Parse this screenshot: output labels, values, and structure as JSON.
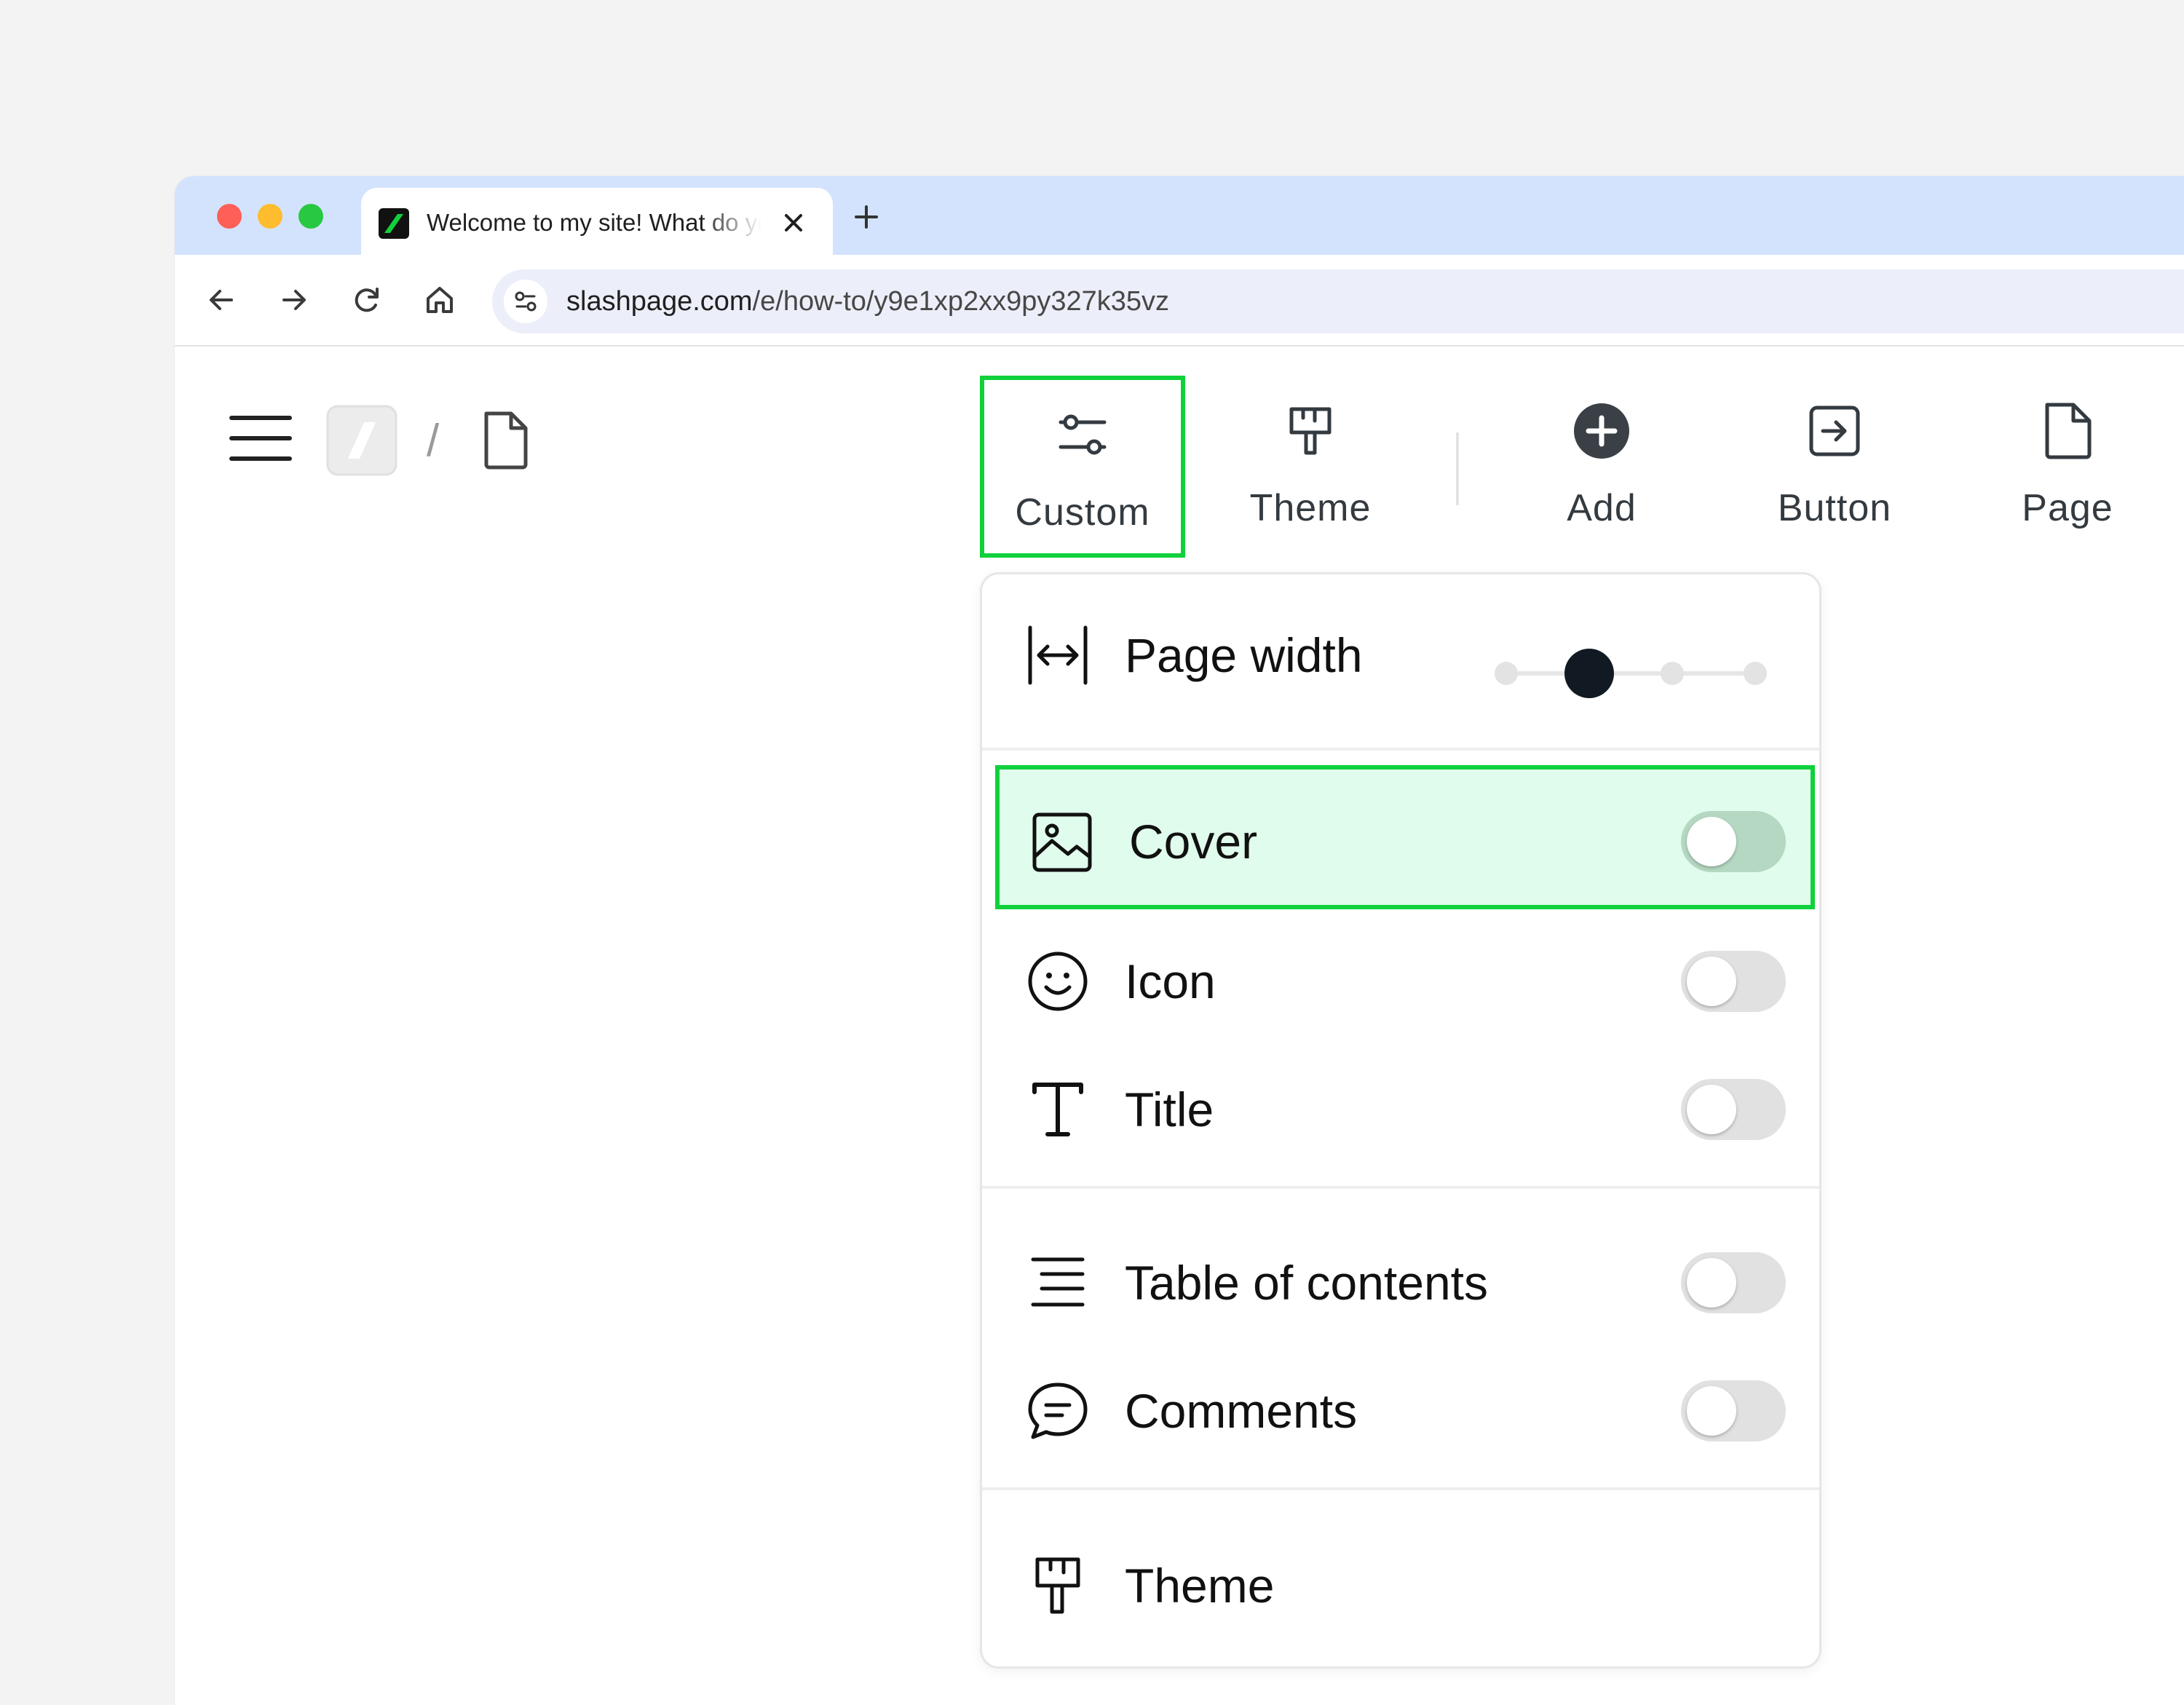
{
  "browser": {
    "tab_title": "Welcome to my site! What do you want to share?",
    "url_host": "slashpage.com",
    "url_path": "/e/how-to/y9e1xp2xx9py327k35vz",
    "colors": {
      "tabbar": "#d3e3fd",
      "omnibox": "#eceff9"
    }
  },
  "breadcrumb": {
    "separator": "/"
  },
  "toolbar": {
    "items": [
      {
        "label": "Custom",
        "icon": "sliders-icon",
        "active": true
      },
      {
        "label": "Theme",
        "icon": "paint-roller-icon"
      },
      {
        "label": "Add",
        "icon": "plus-circle-icon"
      },
      {
        "label": "Button",
        "icon": "button-arrow-icon"
      },
      {
        "label": "Page",
        "icon": "page-icon"
      }
    ]
  },
  "panel": {
    "page_width": {
      "label": "Page width",
      "level": 2,
      "levels": 4
    },
    "rows": [
      {
        "label": "Cover",
        "icon": "image-icon",
        "enabled": false,
        "highlighted": true
      },
      {
        "label": "Icon",
        "icon": "smiley-icon",
        "enabled": false
      },
      {
        "label": "Title",
        "icon": "text-t-icon",
        "enabled": false
      },
      {
        "label": "Table of contents",
        "icon": "toc-icon",
        "enabled": false
      },
      {
        "label": "Comments",
        "icon": "comment-icon",
        "enabled": false
      },
      {
        "label": "Theme",
        "icon": "paint-roller-icon"
      }
    ]
  },
  "highlight_color": "#10d13c"
}
